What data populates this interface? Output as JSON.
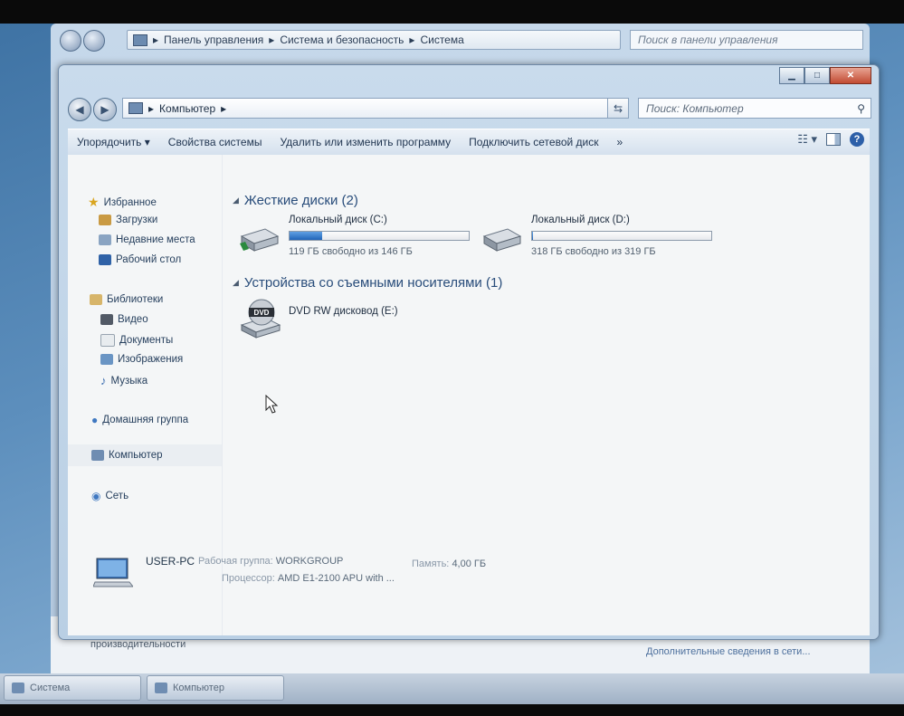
{
  "background_window": {
    "address_path": [
      "Панель управления",
      "Система и безопасность",
      "Система"
    ],
    "search_placeholder": "Поиск в панели управления",
    "bottom_left_link": "Счетчики и средства производительности",
    "bottom_right_link": "Дополнительные сведения в сети..."
  },
  "window": {
    "address_path": [
      "Компьютер"
    ],
    "search_placeholder": "Поиск: Компьютер",
    "toolbar": {
      "organize": "Упорядочить",
      "system_properties": "Свойства системы",
      "uninstall": "Удалить или изменить программу",
      "map_drive": "Подключить сетевой диск",
      "more": "»"
    }
  },
  "sidebar": {
    "favorites": "Избранное",
    "favorites_items": [
      "Загрузки",
      "Недавние места",
      "Рабочий стол"
    ],
    "libraries": "Библиотеки",
    "libraries_items": [
      "Видео",
      "Документы",
      "Изображения",
      "Музыка"
    ],
    "homegroup": "Домашняя группа",
    "computer": "Компьютер",
    "network": "Сеть"
  },
  "groups": {
    "hard_disks": "Жесткие диски (2)",
    "removable": "Устройства со съемными носителями (1)"
  },
  "drives": [
    {
      "name": "Локальный диск (C:)",
      "free": "119 ГБ свободно из 146 ГБ",
      "used_fraction": 0.18
    },
    {
      "name": "Локальный диск (D:)",
      "free": "318 ГБ свободно из 319 ГБ",
      "used_fraction": 0.003
    }
  ],
  "dvd": {
    "name": "DVD RW дисковод (E:)",
    "badge": "DVD"
  },
  "details": {
    "pc_name": "USER-PC",
    "workgroup_label": "Рабочая группа:",
    "workgroup": "WORKGROUP",
    "memory_label": "Память:",
    "memory": "4,00 ГБ",
    "cpu_label": "Процессор:",
    "cpu": "AMD E1-2100 APU with ..."
  },
  "taskbar": [
    "Система",
    "Компьютер"
  ],
  "colors": {
    "accent": "#2064b8",
    "group_title": "#284c7a",
    "close": "#c24b32"
  }
}
